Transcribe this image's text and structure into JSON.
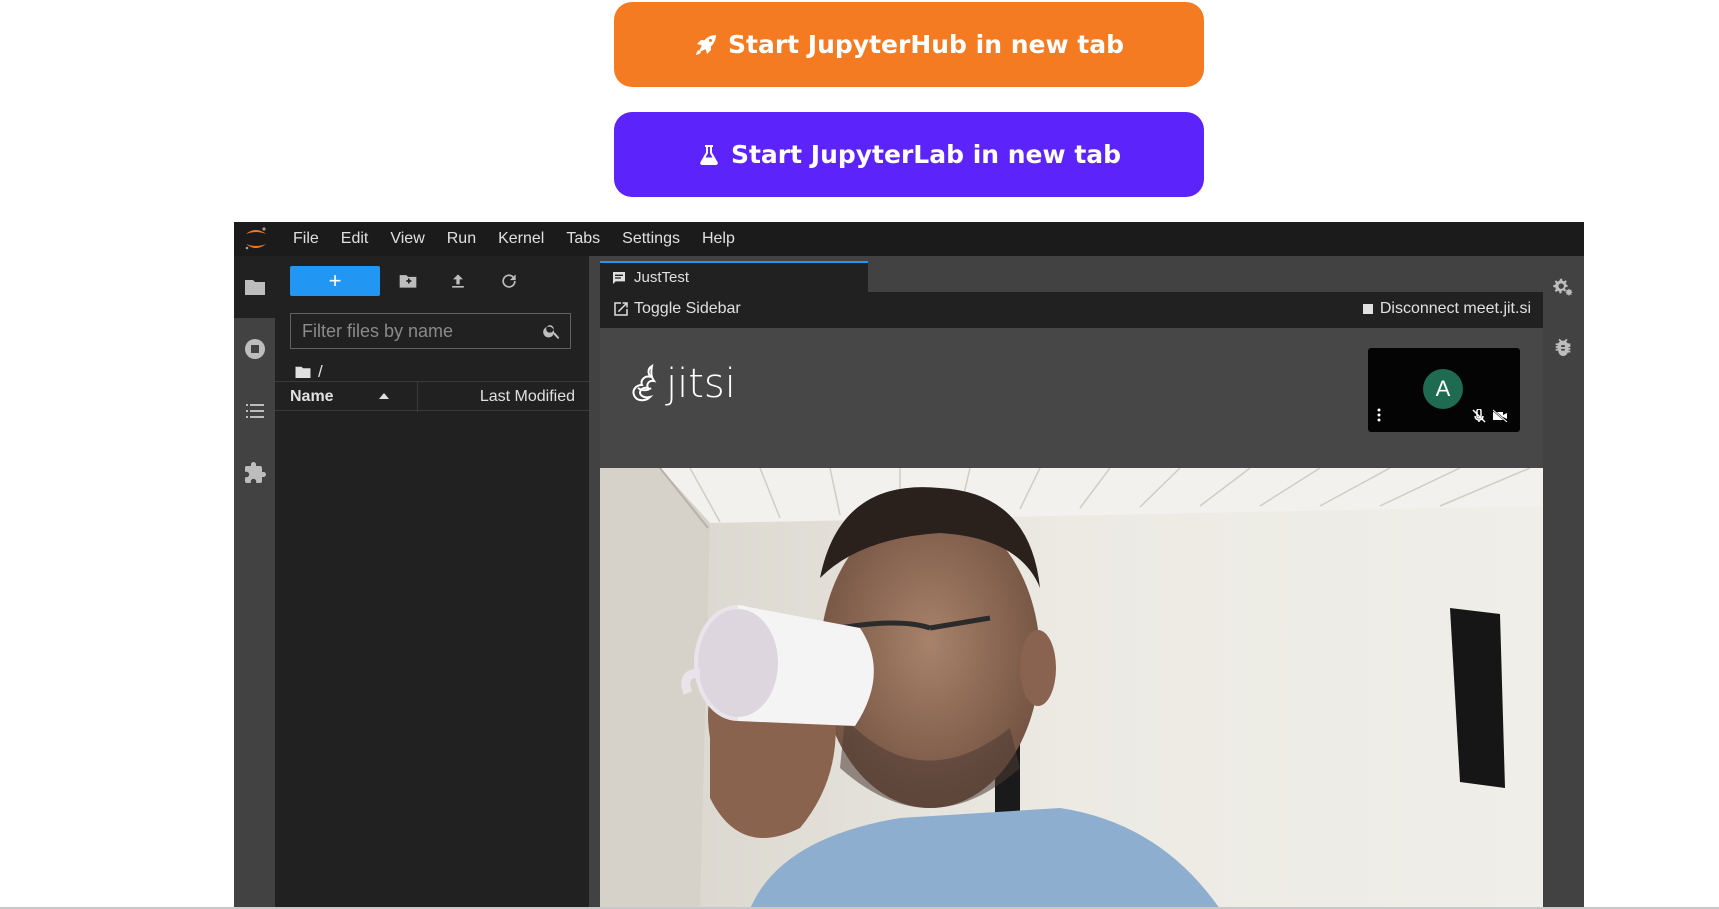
{
  "buttons": {
    "hub_label": "Start JupyterHub in new tab",
    "lab_label": "Start JupyterLab in new tab",
    "hub_color": "#f47b22",
    "lab_color": "#5c24fb"
  },
  "menubar": {
    "items": [
      "File",
      "Edit",
      "View",
      "Run",
      "Kernel",
      "Tabs",
      "Settings",
      "Help"
    ]
  },
  "filebrowser": {
    "new_label": "+",
    "filter_placeholder": "Filter files by name",
    "path": "/",
    "col_name": "Name",
    "col_modified": "Last Modified"
  },
  "tab": {
    "label": "JustTest"
  },
  "toolbar": {
    "toggle_label": "Toggle Sidebar",
    "disconnect_label": "Disconnect meet.jit.si"
  },
  "jitsi": {
    "wordmark": "jitsi",
    "avatar_initial": "A",
    "avatar_color": "#1f6b52"
  },
  "theme": {
    "accent": "#2196f3",
    "panel_dark": "#212121",
    "panel_mid": "#424242"
  }
}
